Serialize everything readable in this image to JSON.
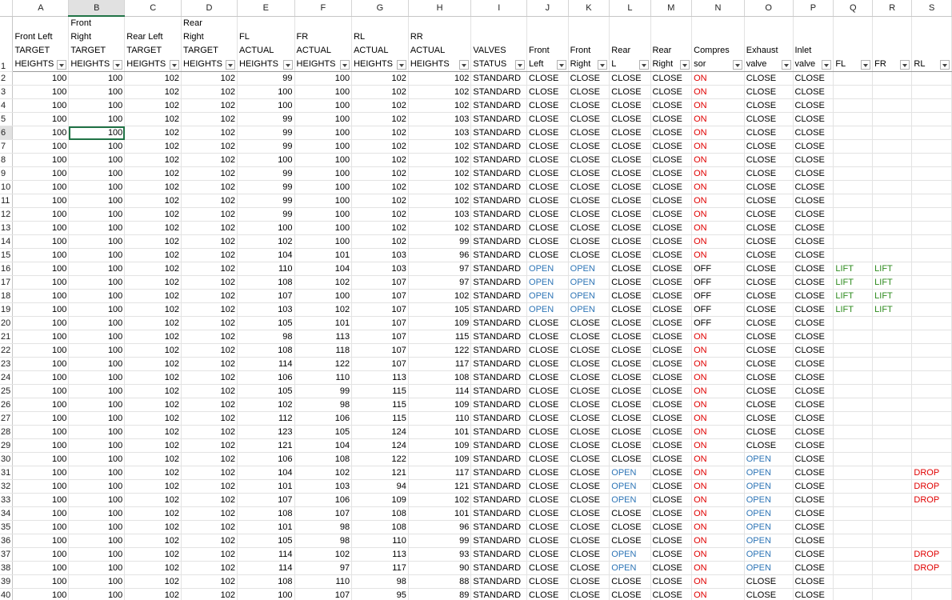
{
  "columns": [
    "A",
    "B",
    "C",
    "D",
    "E",
    "F",
    "G",
    "H",
    "I",
    "J",
    "K",
    "L",
    "M",
    "N",
    "O",
    "P",
    "Q",
    "R",
    "S"
  ],
  "selected": {
    "column": "B",
    "row": 6
  },
  "headers": [
    "Front Left TARGET HEIGHTS",
    "Front Right TARGET HEIGHTS",
    "Rear Left TARGET HEIGHTS",
    "Rear Right TARGET HEIGHTS",
    "FL ACTUAL HEIGHTS",
    "FR ACTUAL HEIGHTS",
    "RL ACTUAL HEIGHTS",
    "RR ACTUAL HEIGHTS",
    "VALVES STATUS",
    "Front Left",
    "Front Right",
    "Rear L",
    "Rear Right",
    "Compres sor",
    "Exhaust valve",
    "Inlet valve",
    "FL",
    "FR",
    "RL"
  ],
  "rows": [
    [
      "100",
      "100",
      "102",
      "102",
      "99",
      "100",
      "102",
      "102",
      "STANDARD",
      "CLOSE",
      "CLOSE",
      "CLOSE",
      "CLOSE",
      "ON",
      "CLOSE",
      "CLOSE",
      "",
      "",
      ""
    ],
    [
      "100",
      "100",
      "102",
      "102",
      "100",
      "100",
      "102",
      "102",
      "STANDARD",
      "CLOSE",
      "CLOSE",
      "CLOSE",
      "CLOSE",
      "ON",
      "CLOSE",
      "CLOSE",
      "",
      "",
      ""
    ],
    [
      "100",
      "100",
      "102",
      "102",
      "100",
      "100",
      "102",
      "102",
      "STANDARD",
      "CLOSE",
      "CLOSE",
      "CLOSE",
      "CLOSE",
      "ON",
      "CLOSE",
      "CLOSE",
      "",
      "",
      ""
    ],
    [
      "100",
      "100",
      "102",
      "102",
      "99",
      "100",
      "102",
      "103",
      "STANDARD",
      "CLOSE",
      "CLOSE",
      "CLOSE",
      "CLOSE",
      "ON",
      "CLOSE",
      "CLOSE",
      "",
      "",
      ""
    ],
    [
      "100",
      "100",
      "102",
      "102",
      "99",
      "100",
      "102",
      "103",
      "STANDARD",
      "CLOSE",
      "CLOSE",
      "CLOSE",
      "CLOSE",
      "ON",
      "CLOSE",
      "CLOSE",
      "",
      "",
      ""
    ],
    [
      "100",
      "100",
      "102",
      "102",
      "99",
      "100",
      "102",
      "102",
      "STANDARD",
      "CLOSE",
      "CLOSE",
      "CLOSE",
      "CLOSE",
      "ON",
      "CLOSE",
      "CLOSE",
      "",
      "",
      ""
    ],
    [
      "100",
      "100",
      "102",
      "102",
      "100",
      "100",
      "102",
      "102",
      "STANDARD",
      "CLOSE",
      "CLOSE",
      "CLOSE",
      "CLOSE",
      "ON",
      "CLOSE",
      "CLOSE",
      "",
      "",
      ""
    ],
    [
      "100",
      "100",
      "102",
      "102",
      "99",
      "100",
      "102",
      "102",
      "STANDARD",
      "CLOSE",
      "CLOSE",
      "CLOSE",
      "CLOSE",
      "ON",
      "CLOSE",
      "CLOSE",
      "",
      "",
      ""
    ],
    [
      "100",
      "100",
      "102",
      "102",
      "99",
      "100",
      "102",
      "102",
      "STANDARD",
      "CLOSE",
      "CLOSE",
      "CLOSE",
      "CLOSE",
      "ON",
      "CLOSE",
      "CLOSE",
      "",
      "",
      ""
    ],
    [
      "100",
      "100",
      "102",
      "102",
      "99",
      "100",
      "102",
      "102",
      "STANDARD",
      "CLOSE",
      "CLOSE",
      "CLOSE",
      "CLOSE",
      "ON",
      "CLOSE",
      "CLOSE",
      "",
      "",
      ""
    ],
    [
      "100",
      "100",
      "102",
      "102",
      "99",
      "100",
      "102",
      "103",
      "STANDARD",
      "CLOSE",
      "CLOSE",
      "CLOSE",
      "CLOSE",
      "ON",
      "CLOSE",
      "CLOSE",
      "",
      "",
      ""
    ],
    [
      "100",
      "100",
      "102",
      "102",
      "100",
      "100",
      "102",
      "102",
      "STANDARD",
      "CLOSE",
      "CLOSE",
      "CLOSE",
      "CLOSE",
      "ON",
      "CLOSE",
      "CLOSE",
      "",
      "",
      ""
    ],
    [
      "100",
      "100",
      "102",
      "102",
      "102",
      "100",
      "102",
      "99",
      "STANDARD",
      "CLOSE",
      "CLOSE",
      "CLOSE",
      "CLOSE",
      "ON",
      "CLOSE",
      "CLOSE",
      "",
      "",
      ""
    ],
    [
      "100",
      "100",
      "102",
      "102",
      "104",
      "101",
      "103",
      "96",
      "STANDARD",
      "CLOSE",
      "CLOSE",
      "CLOSE",
      "CLOSE",
      "ON",
      "CLOSE",
      "CLOSE",
      "",
      "",
      ""
    ],
    [
      "100",
      "100",
      "102",
      "102",
      "110",
      "104",
      "103",
      "97",
      "STANDARD",
      "OPEN",
      "OPEN",
      "CLOSE",
      "CLOSE",
      "OFF",
      "CLOSE",
      "CLOSE",
      "LIFT",
      "LIFT",
      ""
    ],
    [
      "100",
      "100",
      "102",
      "102",
      "108",
      "102",
      "107",
      "97",
      "STANDARD",
      "OPEN",
      "OPEN",
      "CLOSE",
      "CLOSE",
      "OFF",
      "CLOSE",
      "CLOSE",
      "LIFT",
      "LIFT",
      ""
    ],
    [
      "100",
      "100",
      "102",
      "102",
      "107",
      "100",
      "107",
      "102",
      "STANDARD",
      "OPEN",
      "OPEN",
      "CLOSE",
      "CLOSE",
      "OFF",
      "CLOSE",
      "CLOSE",
      "LIFT",
      "LIFT",
      ""
    ],
    [
      "100",
      "100",
      "102",
      "102",
      "103",
      "102",
      "107",
      "105",
      "STANDARD",
      "OPEN",
      "OPEN",
      "CLOSE",
      "CLOSE",
      "OFF",
      "CLOSE",
      "CLOSE",
      "LIFT",
      "LIFT",
      ""
    ],
    [
      "100",
      "100",
      "102",
      "102",
      "105",
      "101",
      "107",
      "109",
      "STANDARD",
      "CLOSE",
      "CLOSE",
      "CLOSE",
      "CLOSE",
      "OFF",
      "CLOSE",
      "CLOSE",
      "",
      "",
      ""
    ],
    [
      "100",
      "100",
      "102",
      "102",
      "98",
      "113",
      "107",
      "115",
      "STANDARD",
      "CLOSE",
      "CLOSE",
      "CLOSE",
      "CLOSE",
      "ON",
      "CLOSE",
      "CLOSE",
      "",
      "",
      ""
    ],
    [
      "100",
      "100",
      "102",
      "102",
      "108",
      "118",
      "107",
      "122",
      "STANDARD",
      "CLOSE",
      "CLOSE",
      "CLOSE",
      "CLOSE",
      "ON",
      "CLOSE",
      "CLOSE",
      "",
      "",
      ""
    ],
    [
      "100",
      "100",
      "102",
      "102",
      "114",
      "122",
      "107",
      "117",
      "STANDARD",
      "CLOSE",
      "CLOSE",
      "CLOSE",
      "CLOSE",
      "ON",
      "CLOSE",
      "CLOSE",
      "",
      "",
      ""
    ],
    [
      "100",
      "100",
      "102",
      "102",
      "106",
      "110",
      "113",
      "108",
      "STANDARD",
      "CLOSE",
      "CLOSE",
      "CLOSE",
      "CLOSE",
      "ON",
      "CLOSE",
      "CLOSE",
      "",
      "",
      ""
    ],
    [
      "100",
      "100",
      "102",
      "102",
      "105",
      "99",
      "115",
      "114",
      "STANDARD",
      "CLOSE",
      "CLOSE",
      "CLOSE",
      "CLOSE",
      "ON",
      "CLOSE",
      "CLOSE",
      "",
      "",
      ""
    ],
    [
      "100",
      "100",
      "102",
      "102",
      "102",
      "98",
      "115",
      "109",
      "STANDARD",
      "CLOSE",
      "CLOSE",
      "CLOSE",
      "CLOSE",
      "ON",
      "CLOSE",
      "CLOSE",
      "",
      "",
      ""
    ],
    [
      "100",
      "100",
      "102",
      "102",
      "112",
      "106",
      "115",
      "110",
      "STANDARD",
      "CLOSE",
      "CLOSE",
      "CLOSE",
      "CLOSE",
      "ON",
      "CLOSE",
      "CLOSE",
      "",
      "",
      ""
    ],
    [
      "100",
      "100",
      "102",
      "102",
      "123",
      "105",
      "124",
      "101",
      "STANDARD",
      "CLOSE",
      "CLOSE",
      "CLOSE",
      "CLOSE",
      "ON",
      "CLOSE",
      "CLOSE",
      "",
      "",
      ""
    ],
    [
      "100",
      "100",
      "102",
      "102",
      "121",
      "104",
      "124",
      "109",
      "STANDARD",
      "CLOSE",
      "CLOSE",
      "CLOSE",
      "CLOSE",
      "ON",
      "CLOSE",
      "CLOSE",
      "",
      "",
      ""
    ],
    [
      "100",
      "100",
      "102",
      "102",
      "106",
      "108",
      "122",
      "109",
      "STANDARD",
      "CLOSE",
      "CLOSE",
      "CLOSE",
      "CLOSE",
      "ON",
      "OPEN",
      "CLOSE",
      "",
      "",
      ""
    ],
    [
      "100",
      "100",
      "102",
      "102",
      "104",
      "102",
      "121",
      "117",
      "STANDARD",
      "CLOSE",
      "CLOSE",
      "OPEN",
      "CLOSE",
      "ON",
      "OPEN",
      "CLOSE",
      "",
      "",
      "DROP"
    ],
    [
      "100",
      "100",
      "102",
      "102",
      "101",
      "103",
      "94",
      "121",
      "STANDARD",
      "CLOSE",
      "CLOSE",
      "OPEN",
      "CLOSE",
      "ON",
      "OPEN",
      "CLOSE",
      "",
      "",
      "DROP"
    ],
    [
      "100",
      "100",
      "102",
      "102",
      "107",
      "106",
      "109",
      "102",
      "STANDARD",
      "CLOSE",
      "CLOSE",
      "OPEN",
      "CLOSE",
      "ON",
      "OPEN",
      "CLOSE",
      "",
      "",
      "DROP"
    ],
    [
      "100",
      "100",
      "102",
      "102",
      "108",
      "107",
      "108",
      "101",
      "STANDARD",
      "CLOSE",
      "CLOSE",
      "CLOSE",
      "CLOSE",
      "ON",
      "OPEN",
      "CLOSE",
      "",
      "",
      ""
    ],
    [
      "100",
      "100",
      "102",
      "102",
      "101",
      "98",
      "108",
      "96",
      "STANDARD",
      "CLOSE",
      "CLOSE",
      "CLOSE",
      "CLOSE",
      "ON",
      "OPEN",
      "CLOSE",
      "",
      "",
      ""
    ],
    [
      "100",
      "100",
      "102",
      "102",
      "105",
      "98",
      "110",
      "99",
      "STANDARD",
      "CLOSE",
      "CLOSE",
      "CLOSE",
      "CLOSE",
      "ON",
      "OPEN",
      "CLOSE",
      "",
      "",
      ""
    ],
    [
      "100",
      "100",
      "102",
      "102",
      "114",
      "102",
      "113",
      "93",
      "STANDARD",
      "CLOSE",
      "CLOSE",
      "OPEN",
      "CLOSE",
      "ON",
      "OPEN",
      "CLOSE",
      "",
      "",
      "DROP"
    ],
    [
      "100",
      "100",
      "102",
      "102",
      "114",
      "97",
      "117",
      "90",
      "STANDARD",
      "CLOSE",
      "CLOSE",
      "OPEN",
      "CLOSE",
      "ON",
      "OPEN",
      "CLOSE",
      "",
      "",
      "DROP"
    ],
    [
      "100",
      "100",
      "102",
      "102",
      "108",
      "110",
      "98",
      "88",
      "STANDARD",
      "CLOSE",
      "CLOSE",
      "CLOSE",
      "CLOSE",
      "ON",
      "CLOSE",
      "CLOSE",
      "",
      "",
      ""
    ],
    [
      "100",
      "100",
      "102",
      "102",
      "100",
      "107",
      "95",
      "89",
      "STANDARD",
      "CLOSE",
      "CLOSE",
      "CLOSE",
      "CLOSE",
      "ON",
      "CLOSE",
      "CLOSE",
      "",
      "",
      ""
    ]
  ]
}
